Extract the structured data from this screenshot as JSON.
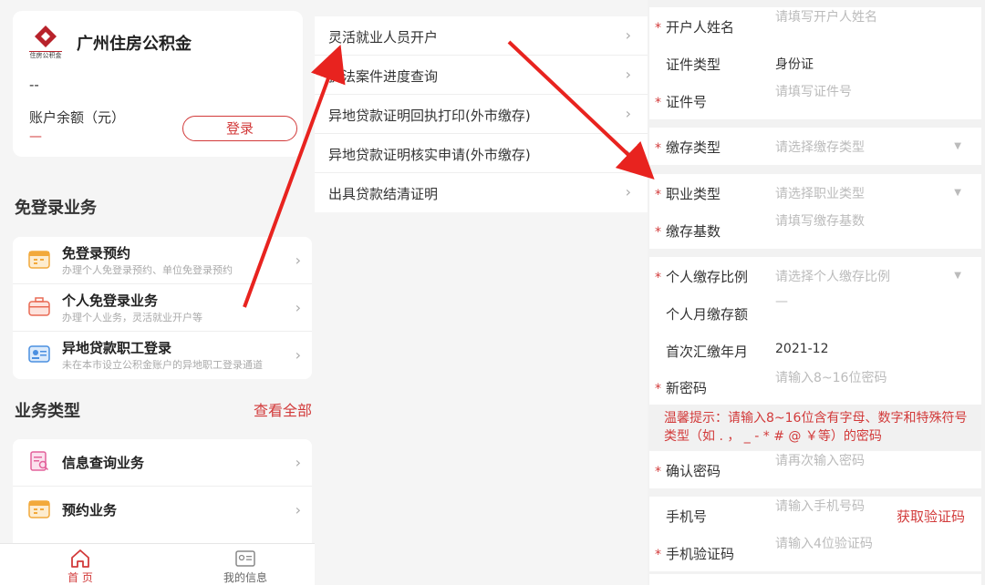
{
  "left": {
    "org_name": "广州住房公积金",
    "logo_text": "住房公积金",
    "account_dash": "--",
    "balance_label": "账户余额（元）",
    "balance_value": "—",
    "login_button": "登录",
    "free_section_title": "免登录业务",
    "free_items": [
      {
        "title": "免登录预约",
        "subtitle": "办理个人免登录预约、单位免登录预约",
        "icon": "calendar-icon"
      },
      {
        "title": "个人免登录业务",
        "subtitle": "办理个人业务，灵活就业开户等",
        "icon": "briefcase-icon"
      },
      {
        "title": "异地贷款职工登录",
        "subtitle": "未在本市设立公积金账户的异地职工登录通道",
        "icon": "id-card-icon"
      }
    ],
    "biz_section_title": "业务类型",
    "view_all": "查看全部",
    "biz_items": [
      {
        "title": "信息查询业务",
        "icon": "document-search-icon"
      },
      {
        "title": "预约业务",
        "icon": "calendar-icon"
      }
    ],
    "tabs": [
      {
        "label": "首 页",
        "icon": "home-icon",
        "color": "#d23a3a"
      },
      {
        "label": "我的信息",
        "icon": "profile-card-icon",
        "color": "#666666"
      }
    ]
  },
  "middle": {
    "menu_items": [
      "灵活就业人员开户",
      "执法案件进度查询",
      "异地贷款证明回执打印(外市缴存)",
      "异地贷款证明核实申请(外市缴存)",
      "出具贷款结清证明"
    ]
  },
  "right": {
    "fields": [
      {
        "label": "开户人姓名",
        "required": true,
        "placeholder": "请填写开户人姓名"
      },
      {
        "label": "证件类型",
        "required": false,
        "value": "身份证"
      },
      {
        "label": "证件号",
        "required": true,
        "placeholder": "请填写证件号"
      },
      {
        "label": "缴存类型",
        "required": true,
        "placeholder": "请选择缴存类型"
      },
      {
        "label": "职业类型",
        "required": true,
        "placeholder": "请选择职业类型"
      },
      {
        "label": "缴存基数",
        "required": true,
        "placeholder": "请填写缴存基数"
      },
      {
        "label": "个人缴存比例",
        "required": true,
        "placeholder": "请选择个人缴存比例"
      },
      {
        "label": "个人月缴存额",
        "required": false,
        "placeholder": "—"
      },
      {
        "label": "首次汇缴年月",
        "required": false,
        "value": "2021-12"
      },
      {
        "label": "新密码",
        "required": true,
        "placeholder": "请输入8~16位密码"
      },
      {
        "label": "确认密码",
        "required": true,
        "placeholder": "请再次输入密码"
      },
      {
        "label": "手机号",
        "required": false,
        "placeholder": "请输入手机号码"
      },
      {
        "label": "手机验证码",
        "required": true,
        "placeholder": "请输入4位验证码"
      }
    ],
    "password_tip": "温馨提示：请输入8~16位含有字母、数字和特殊符号类型（如 . ， _ - * # @ ￥等）的密码",
    "get_code": "获取验证码"
  },
  "colors": {
    "accent": "#d23a3a",
    "arrow": "#e8231f"
  }
}
